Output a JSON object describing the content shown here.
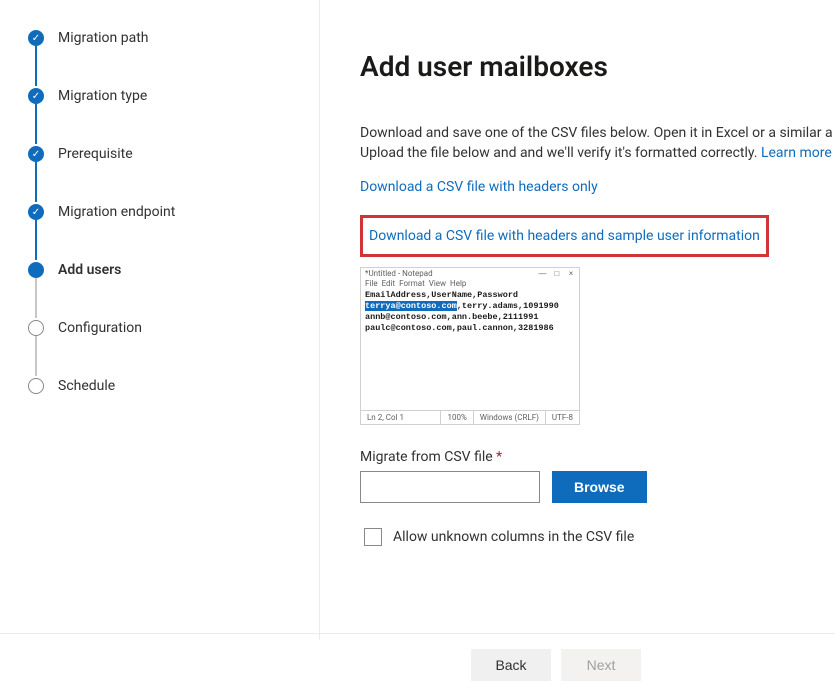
{
  "steps": [
    {
      "label": "Migration path",
      "state": "completed"
    },
    {
      "label": "Migration type",
      "state": "completed"
    },
    {
      "label": "Prerequisite",
      "state": "completed"
    },
    {
      "label": "Migration endpoint",
      "state": "completed"
    },
    {
      "label": "Add users",
      "state": "active"
    },
    {
      "label": "Configuration",
      "state": "pending"
    },
    {
      "label": "Schedule",
      "state": "pending"
    }
  ],
  "main": {
    "title": "Add user mailboxes",
    "description_part1": "Download and save one of the CSV files below. Open it in Excel or a similar a",
    "description_part2": "Upload the file below and and we'll verify it's formatted correctly. ",
    "learn_more": "Learn more",
    "link_headers_only": "Download a CSV file with headers only",
    "link_headers_sample": "Download a CSV file with headers and sample user information",
    "notepad": {
      "title": "*Untitled - Notepad",
      "menu": [
        "File",
        "Edit",
        "Format",
        "View",
        "Help"
      ],
      "line_header": "EmailAddress,UserName,Password",
      "line2_sel": "terrya@contoso.com",
      "line2_rest": ",terry.adams,1091990",
      "line3": "annb@contoso.com,ann.beebe,2111991",
      "line4": "paulc@contoso.com,paul.cannon,3281986",
      "status_pos": "Ln 2, Col 1",
      "status_zoom": "100%",
      "status_enc": "Windows (CRLF)",
      "status_utf": "UTF-8"
    },
    "csv_label": "Migrate from CSV file ",
    "required_mark": "*",
    "browse": "Browse",
    "allow_unknown": "Allow unknown columns in the CSV file"
  },
  "footer": {
    "back": "Back",
    "next": "Next"
  }
}
